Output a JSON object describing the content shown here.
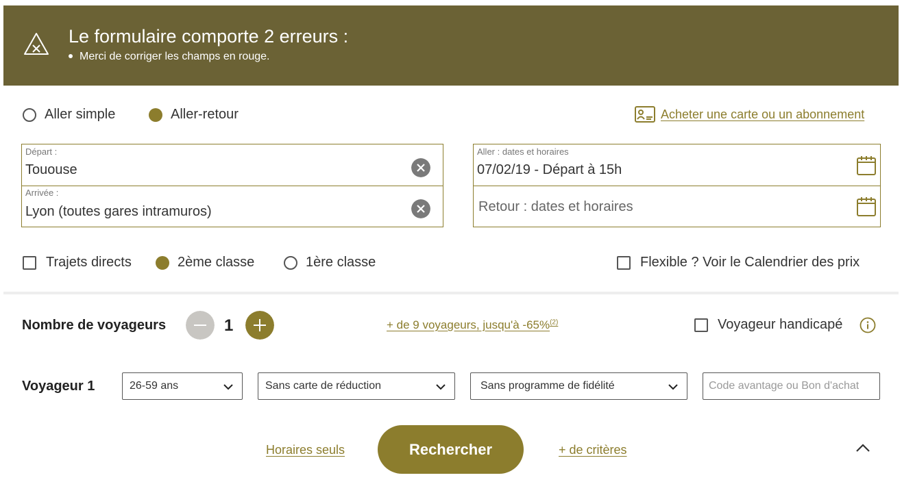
{
  "error_banner": {
    "title": "Le formulaire comporte 2 erreurs :",
    "message": "Merci de corriger les champs en rouge."
  },
  "trip_type": {
    "one_way_label": "Aller simple",
    "round_trip_label": "Aller-retour",
    "selected": "Aller-retour"
  },
  "card_link": "Acheter une carte ou un abonnement",
  "departure": {
    "label": "Départ :",
    "value": "Tououse"
  },
  "arrival": {
    "label": "Arrivée :",
    "value": "Lyon (toutes gares intramuros)"
  },
  "outbound": {
    "label": "Aller : dates et horaires",
    "value": "07/02/19 - Départ à 15h"
  },
  "return": {
    "placeholder": "Retour : dates et horaires"
  },
  "options": {
    "direct_label": "Trajets directs",
    "second_class_label": "2ème classe",
    "first_class_label": "1ère classe",
    "class_selected": "2ème classe",
    "flexible_label": "Flexible ? Voir le Calendrier des prix"
  },
  "travelers": {
    "label": "Nombre de voyageurs",
    "count": "1",
    "group_link": "+ de 9 voyageurs, jusqu'à -65%",
    "group_sup": "(2)",
    "handicap_label": "Voyageur handicapé"
  },
  "traveler1": {
    "label": "Voyageur 1",
    "age": "26-59 ans",
    "card": "Sans carte de réduction",
    "loyalty": "Sans programme de fidélité",
    "code_placeholder": "Code avantage ou Bon d'achat"
  },
  "actions": {
    "schedules_link": "Horaires seuls",
    "search_label": "Rechercher",
    "more_criteria_link": "+ de critères"
  },
  "colors": {
    "banner": "#6b6235",
    "accent": "#8c7d2d"
  }
}
